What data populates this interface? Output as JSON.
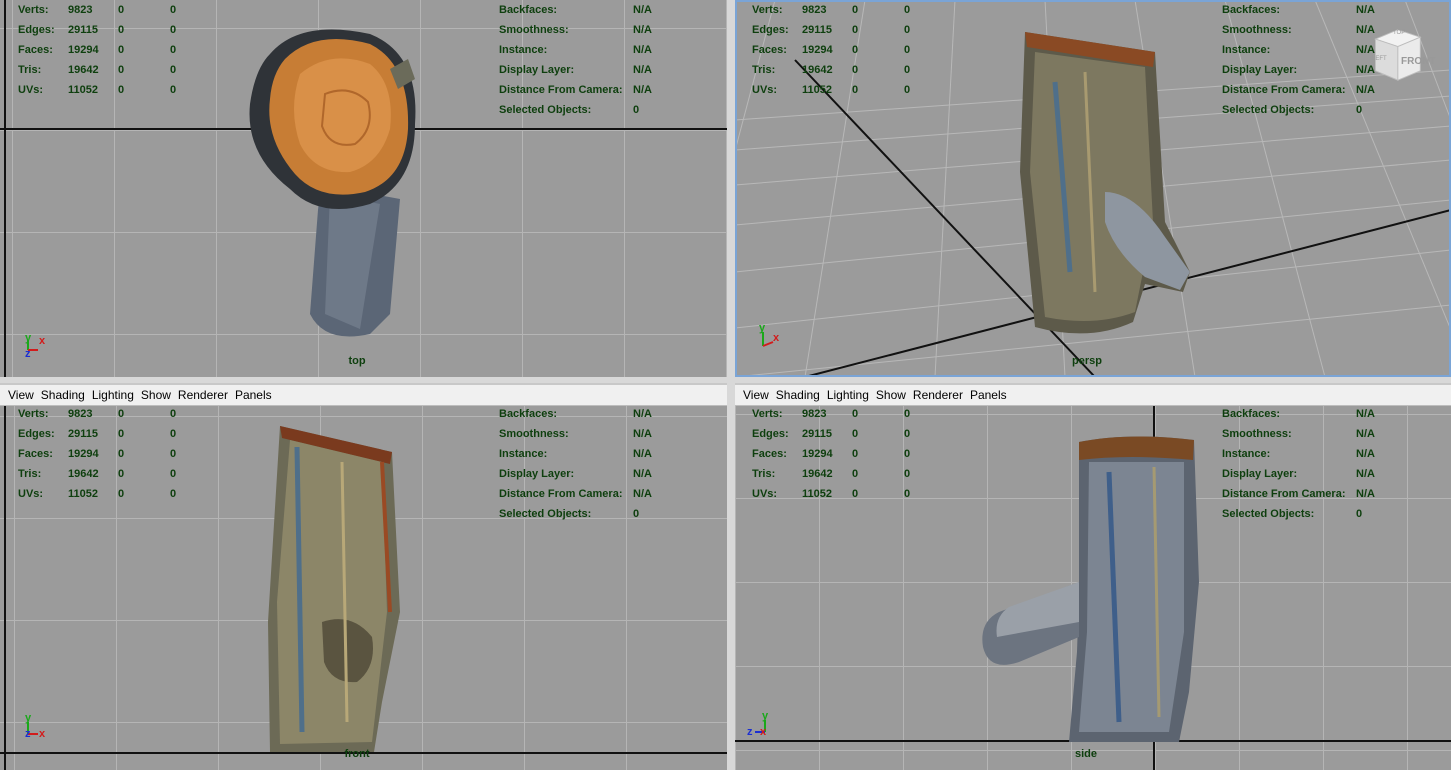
{
  "menu": [
    "View",
    "Shading",
    "Lighting",
    "Show",
    "Renderer",
    "Panels"
  ],
  "hud": {
    "stats": [
      {
        "label": "Verts:",
        "v1": "9823",
        "v2": "0",
        "v3": "0"
      },
      {
        "label": "Edges:",
        "v1": "29115",
        "v2": "0",
        "v3": "0"
      },
      {
        "label": "Faces:",
        "v1": "19294",
        "v2": "0",
        "v3": "0"
      },
      {
        "label": "Tris:",
        "v1": "19642",
        "v2": "0",
        "v3": "0"
      },
      {
        "label": "UVs:",
        "v1": "11052",
        "v2": "0",
        "v3": "0"
      }
    ],
    "info": [
      {
        "label": "Backfaces:",
        "value": "N/A"
      },
      {
        "label": "Smoothness:",
        "value": "N/A"
      },
      {
        "label": "Instance:",
        "value": "N/A"
      },
      {
        "label": "Display Layer:",
        "value": "N/A"
      },
      {
        "label": "Distance From Camera:",
        "value": "N/A"
      },
      {
        "label": "Selected Objects:",
        "value": "0"
      }
    ]
  },
  "panes": {
    "top": {
      "camera": "top"
    },
    "persp": {
      "camera": "persp",
      "viewcube": {
        "front": "FRONT",
        "left": "LEFT",
        "top": "TOP"
      }
    },
    "front": {
      "camera": "front"
    },
    "side": {
      "camera": "side"
    }
  },
  "axes": {
    "x": "x",
    "y": "y",
    "z": "z"
  },
  "colors": {
    "viewport_bg": "#9b9b9b",
    "grid": "#b5b5b5",
    "hud_text": "#0e3f0e",
    "axis_x": "#d21c1c",
    "axis_y": "#1aa81a",
    "axis_z": "#1c2fd2"
  }
}
